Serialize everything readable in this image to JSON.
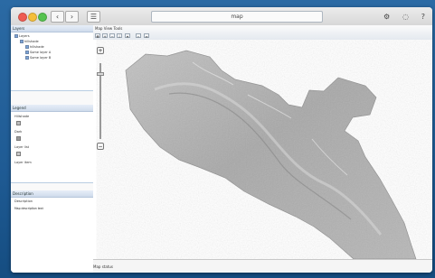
{
  "window": {
    "title": "map"
  },
  "toolbar": {
    "address": "map",
    "back_icon": "chevron-left-icon",
    "forward_icon": "chevron-right-icon",
    "menu_icon": "menu-icon"
  },
  "top_icons": [
    "gear-icon",
    "person-icon",
    "question-icon"
  ],
  "left_panel": {
    "layers": {
      "header": "Layers",
      "items": [
        "Layers",
        "hillshade",
        "hillshade",
        "Some layer A",
        "Some layer B"
      ]
    },
    "legend": {
      "header": "Legend",
      "items": [
        "Hillshade",
        "Dark",
        "Layer list",
        "Layer item"
      ]
    },
    "description": {
      "header": "Description",
      "label": "Description",
      "text": "Map description text"
    }
  },
  "map": {
    "tabs_label": "Map  View  Tools",
    "zoom_plus": "+",
    "zoom_minus": "−",
    "status": "Map status"
  },
  "colors": {
    "desktop": "#1f5a8f",
    "terrain": "#a7a7a7"
  }
}
